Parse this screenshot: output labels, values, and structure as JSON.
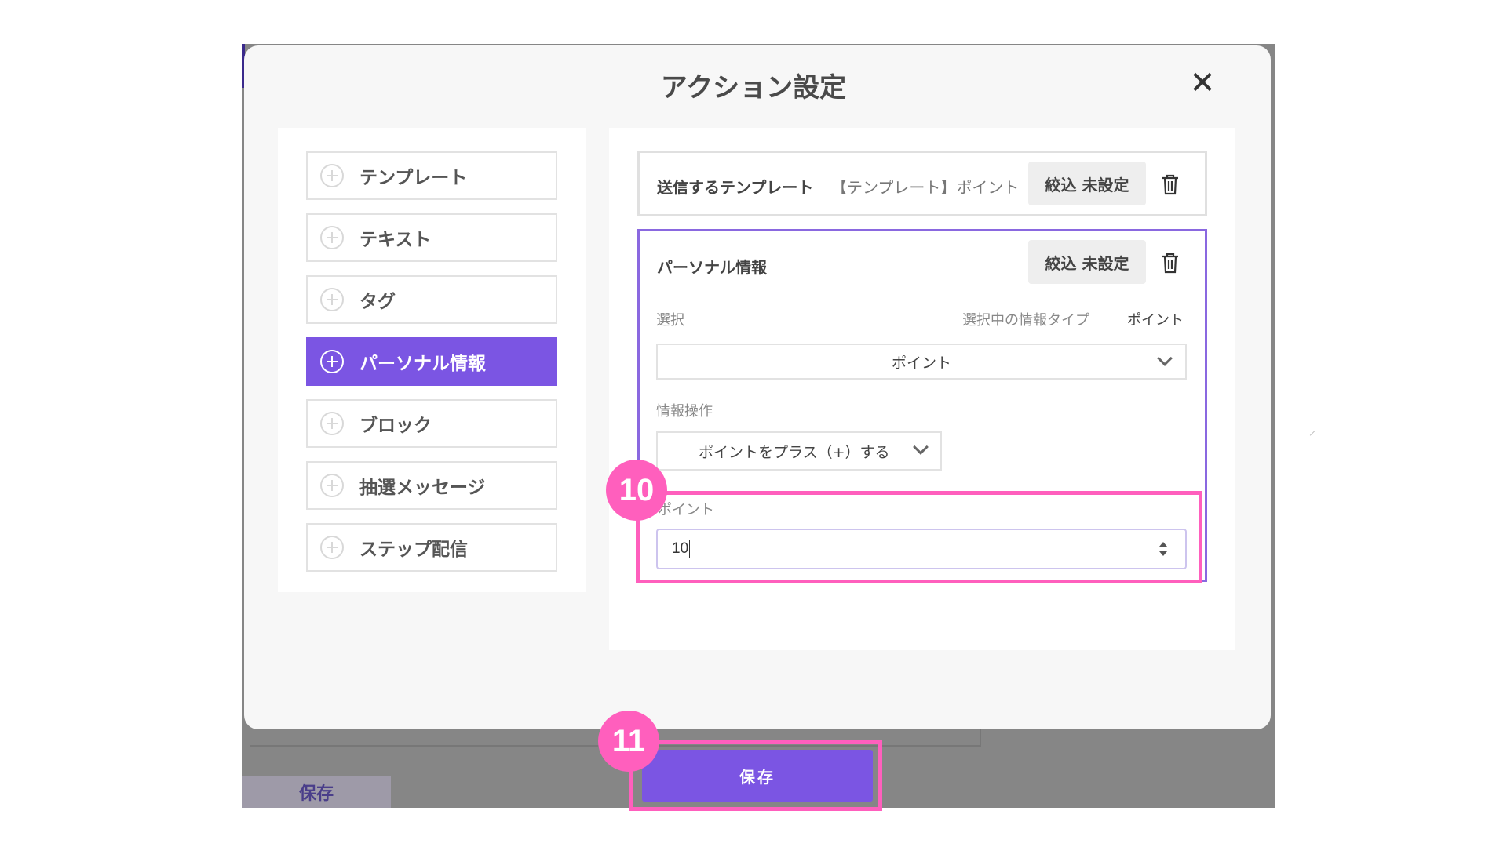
{
  "modal": {
    "title": "アクション設定",
    "close_icon": "close-icon"
  },
  "menu": {
    "items": [
      {
        "label": "テンプレート",
        "active": false
      },
      {
        "label": "テキスト",
        "active": false
      },
      {
        "label": "タグ",
        "active": false
      },
      {
        "label": "パーソナル情報",
        "active": true
      },
      {
        "label": "ブロック",
        "active": false
      },
      {
        "label": "抽選メッセージ",
        "active": false
      },
      {
        "label": "ステップ配信",
        "active": false
      }
    ]
  },
  "template_card": {
    "label": "送信するテンプレート",
    "value": "【テンプレート】ポイント",
    "filter_button": "絞込 未設定"
  },
  "personal_card": {
    "title": "パーソナル情報",
    "filter_button": "絞込 未設定",
    "select_label": "選択",
    "selected_type_label": "選択中の情報タイプ",
    "selected_type_value": "ポイント",
    "select_value": "ポイント",
    "operation_label": "情報操作",
    "operation_value": "ポイントをプラス（+）する",
    "point_label": "ポイント",
    "point_value": "10"
  },
  "annotations": {
    "badge_10": "10",
    "badge_11": "11",
    "color": "#ff5fbd"
  },
  "footer": {
    "save_label": "保存",
    "background_save_label": "保存"
  },
  "colors": {
    "accent": "#7b55e3",
    "backdrop": "#868686",
    "highlight": "#ff5fbd"
  }
}
